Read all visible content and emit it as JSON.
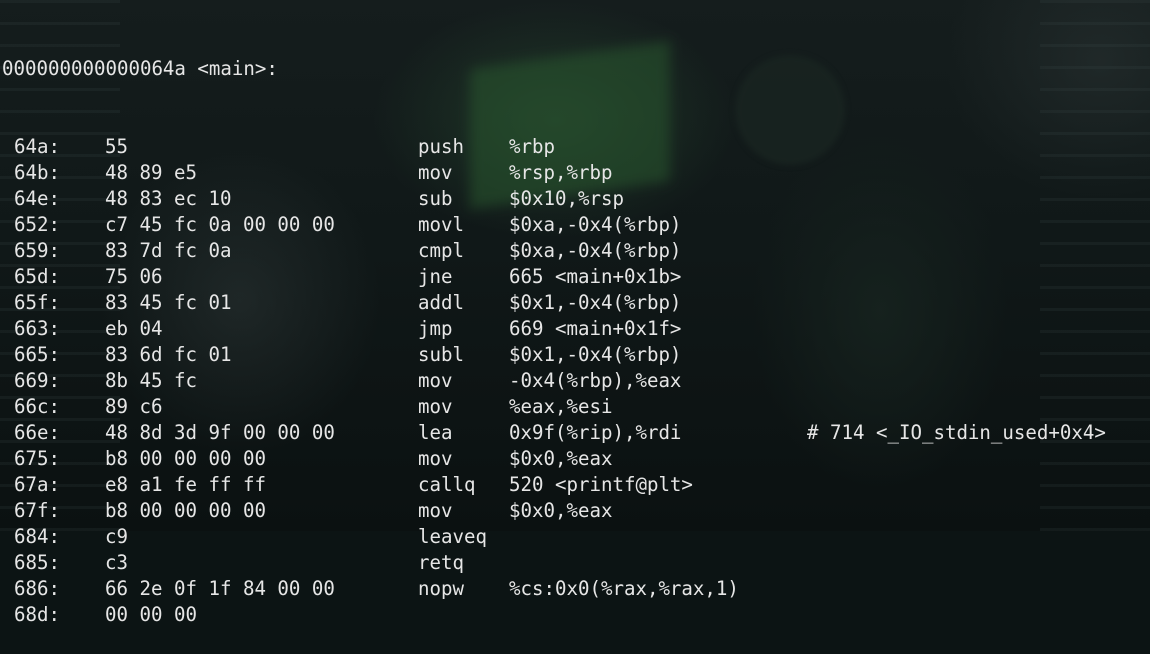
{
  "header": "000000000000064a <main>:",
  "instructions": [
    {
      "addr": "64a:",
      "bytes": "55",
      "mnemonic": "push",
      "operands": "%rbp",
      "comment": ""
    },
    {
      "addr": "64b:",
      "bytes": "48 89 e5",
      "mnemonic": "mov",
      "operands": "%rsp,%rbp",
      "comment": ""
    },
    {
      "addr": "64e:",
      "bytes": "48 83 ec 10",
      "mnemonic": "sub",
      "operands": "$0x10,%rsp",
      "comment": ""
    },
    {
      "addr": "652:",
      "bytes": "c7 45 fc 0a 00 00 00",
      "mnemonic": "movl",
      "operands": "$0xa,-0x4(%rbp)",
      "comment": ""
    },
    {
      "addr": "659:",
      "bytes": "83 7d fc 0a",
      "mnemonic": "cmpl",
      "operands": "$0xa,-0x4(%rbp)",
      "comment": ""
    },
    {
      "addr": "65d:",
      "bytes": "75 06",
      "mnemonic": "jne",
      "operands": "665 <main+0x1b>",
      "comment": ""
    },
    {
      "addr": "65f:",
      "bytes": "83 45 fc 01",
      "mnemonic": "addl",
      "operands": "$0x1,-0x4(%rbp)",
      "comment": ""
    },
    {
      "addr": "663:",
      "bytes": "eb 04",
      "mnemonic": "jmp",
      "operands": "669 <main+0x1f>",
      "comment": ""
    },
    {
      "addr": "665:",
      "bytes": "83 6d fc 01",
      "mnemonic": "subl",
      "operands": "$0x1,-0x4(%rbp)",
      "comment": ""
    },
    {
      "addr": "669:",
      "bytes": "8b 45 fc",
      "mnemonic": "mov",
      "operands": "-0x4(%rbp),%eax",
      "comment": ""
    },
    {
      "addr": "66c:",
      "bytes": "89 c6",
      "mnemonic": "mov",
      "operands": "%eax,%esi",
      "comment": ""
    },
    {
      "addr": "66e:",
      "bytes": "48 8d 3d 9f 00 00 00",
      "mnemonic": "lea",
      "operands": "0x9f(%rip),%rdi",
      "comment": "# 714 <_IO_stdin_used+0x4>"
    },
    {
      "addr": "675:",
      "bytes": "b8 00 00 00 00",
      "mnemonic": "mov",
      "operands": "$0x0,%eax",
      "comment": ""
    },
    {
      "addr": "67a:",
      "bytes": "e8 a1 fe ff ff",
      "mnemonic": "callq",
      "operands": "520 <printf@plt>",
      "comment": ""
    },
    {
      "addr": "67f:",
      "bytes": "b8 00 00 00 00",
      "mnemonic": "mov",
      "operands": "$0x0,%eax",
      "comment": ""
    },
    {
      "addr": "684:",
      "bytes": "c9",
      "mnemonic": "leaveq",
      "operands": "",
      "comment": ""
    },
    {
      "addr": "685:",
      "bytes": "c3",
      "mnemonic": "retq",
      "operands": "",
      "comment": ""
    },
    {
      "addr": "686:",
      "bytes": "66 2e 0f 1f 84 00 00",
      "mnemonic": "nopw",
      "operands": "%cs:0x0(%rax,%rax,1)",
      "comment": ""
    },
    {
      "addr": "68d:",
      "bytes": "00 00 00",
      "mnemonic": "",
      "operands": "",
      "comment": ""
    }
  ],
  "colors": {
    "text": "#e6e6e6",
    "background": "#0c1414"
  }
}
